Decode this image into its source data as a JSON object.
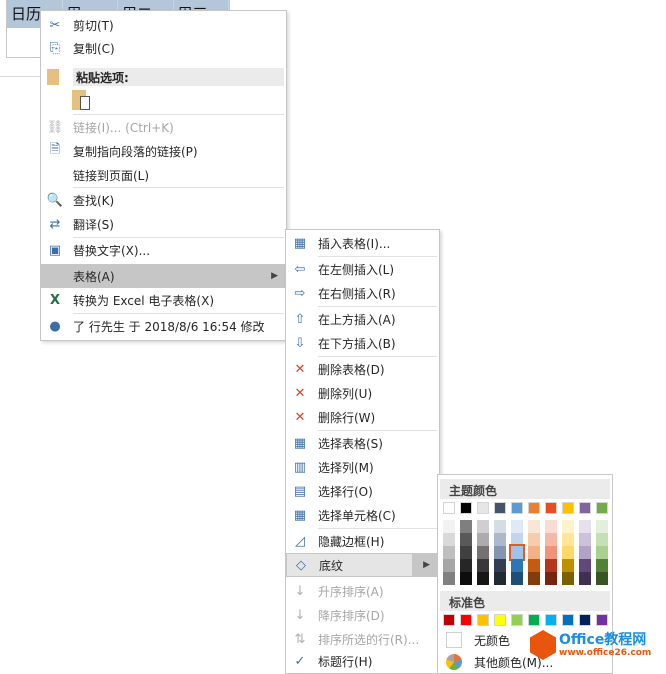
{
  "table": {
    "headers": [
      "日历",
      "周一",
      "周二",
      "周三"
    ]
  },
  "main_menu": {
    "items": [
      {
        "label": "剪切(T)",
        "icon": "scissors-icon",
        "top": 0
      },
      {
        "label": "复制(C)",
        "icon": "copy-icon"
      },
      {
        "label": "粘贴选项:",
        "icon": "paste-icon",
        "section": true
      },
      {
        "label": "",
        "icon": "paste-keep-icon",
        "pasteopt": true
      },
      {
        "label": "链接(I)...  (Ctrl+K)",
        "icon": "link-icon",
        "disabled": true,
        "sep": true
      },
      {
        "label": "复制指向段落的链接(P)",
        "icon": "paragraph-link-icon"
      },
      {
        "label": "链接到页面(L)",
        "icon": ""
      },
      {
        "label": "查找(K)",
        "icon": "find-icon",
        "sep": true
      },
      {
        "label": "翻译(S)",
        "icon": "translate-icon"
      },
      {
        "label": "替换文字(X)...",
        "icon": "alt-text-icon",
        "sep": true
      },
      {
        "label": "表格(A)",
        "icon": "",
        "highlight": true,
        "submenu": true
      },
      {
        "label": "转换为 Excel 电子表格(X)",
        "icon": "excel-icon"
      },
      {
        "label": "了 行先生 于 2018/8/6 16:54 修改",
        "icon": "user-icon",
        "sep": true
      }
    ]
  },
  "table_menu": {
    "items": [
      {
        "label": "插入表格(I)...",
        "icon": "insert-table-icon"
      },
      {
        "label": "在左侧插入(L)",
        "icon": "insert-left-icon",
        "sep": true
      },
      {
        "label": "在右侧插入(R)",
        "icon": "insert-right-icon"
      },
      {
        "label": "在上方插入(A)",
        "icon": "insert-above-icon",
        "sep": true
      },
      {
        "label": "在下方插入(B)",
        "icon": "insert-below-icon"
      },
      {
        "label": "删除表格(D)",
        "icon": "delete-table-icon",
        "sep": true
      },
      {
        "label": "删除列(U)",
        "icon": "delete-column-icon"
      },
      {
        "label": "删除行(W)",
        "icon": "delete-row-icon"
      },
      {
        "label": "选择表格(S)",
        "icon": "select-table-icon",
        "sep": true
      },
      {
        "label": "选择列(M)",
        "icon": "select-column-icon"
      },
      {
        "label": "选择行(O)",
        "icon": "select-row-icon"
      },
      {
        "label": "选择单元格(C)",
        "icon": "select-cell-icon"
      },
      {
        "label": "隐藏边框(H)",
        "icon": "hide-borders-icon",
        "sep": true
      },
      {
        "label": "底纹",
        "icon": "shading-icon",
        "highlight": true,
        "submenu": true
      },
      {
        "label": "升序排序(A)",
        "icon": "sort-ascending-icon",
        "disabled": true
      },
      {
        "label": "降序排序(D)",
        "icon": "sort-descending-icon",
        "disabled": true
      },
      {
        "label": "排序所选的行(R)...",
        "icon": "sort-rows-icon",
        "disabled": true
      },
      {
        "label": "标题行(H)",
        "icon": "checkmark-icon"
      }
    ]
  },
  "color_panel": {
    "theme_title": "主题颜色",
    "standard_title": "标准色",
    "theme_colors": [
      "#ffffff",
      "#000000",
      "#e7e6e6",
      "#44546a",
      "#5b9bd5",
      "#ed7d31",
      "#e84c22",
      "#ffc000",
      "#8064a2",
      "#70ad47"
    ],
    "shades": [
      [
        "#f2f2f2",
        "#d9d9d9",
        "#bfbfbf",
        "#a6a6a6",
        "#808080"
      ],
      [
        "#7f7f7f",
        "#595959",
        "#404040",
        "#262626",
        "#0d0d0d"
      ],
      [
        "#d0cece",
        "#aeabab",
        "#757171",
        "#3b3838",
        "#171616"
      ],
      [
        "#d6dce5",
        "#adb9ca",
        "#8497b0",
        "#333f50",
        "#222a35"
      ],
      [
        "#deebf7",
        "#bdd7ee",
        "#9dc3e6",
        "#2e75b6",
        "#1f4e79"
      ],
      [
        "#fbe5d6",
        "#f8cbad",
        "#f4b183",
        "#c55a11",
        "#843c0c"
      ],
      [
        "#fadbd3",
        "#f6b7a6",
        "#f1937a",
        "#b5361a",
        "#772411"
      ],
      [
        "#fff2cc",
        "#ffe699",
        "#ffd966",
        "#bf9000",
        "#7f6000"
      ],
      [
        "#e6e0ec",
        "#ccc1da",
        "#b3a2c7",
        "#60497a",
        "#403152"
      ],
      [
        "#e2f0d9",
        "#c5e0b4",
        "#a9d18e",
        "#548235",
        "#375623"
      ]
    ],
    "selected": {
      "column": 4,
      "row": 2
    },
    "standard_colors": [
      "#c00000",
      "#ff0000",
      "#ffc000",
      "#ffff00",
      "#92d050",
      "#00b050",
      "#00b0f0",
      "#0070c0",
      "#002060",
      "#7030a0"
    ],
    "no_color_label": "无颜色",
    "more_colors_label": "其他颜色(M)..."
  },
  "watermark": {
    "line1": "Office教程网",
    "line2": "www.office26.com"
  }
}
